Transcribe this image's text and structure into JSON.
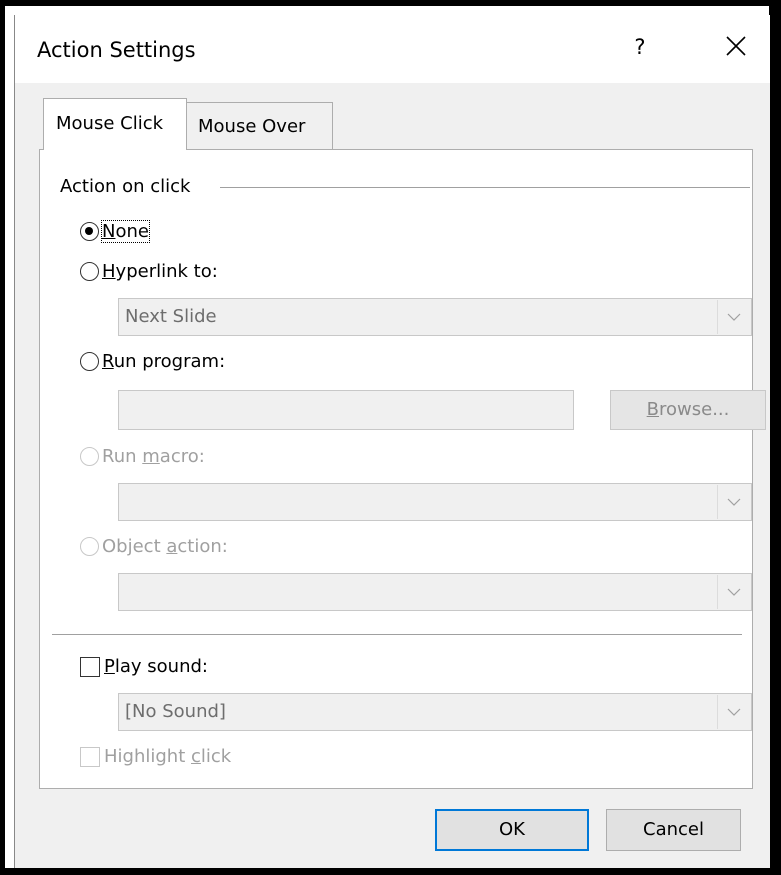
{
  "window": {
    "title": "Action Settings",
    "help_label": "?",
    "close_icon": "close-icon"
  },
  "tabs": [
    {
      "label": "Mouse Click",
      "active": true
    },
    {
      "label": "Mouse Over",
      "active": false
    }
  ],
  "action_group": {
    "label": "Action on click",
    "options": {
      "none": {
        "pre": "",
        "accel": "N",
        "post": "one",
        "checked": true,
        "enabled": true
      },
      "hyperlink": {
        "pre": "",
        "accel": "H",
        "post": "yperlink to:",
        "checked": false,
        "enabled": true
      },
      "run_program": {
        "pre": "",
        "accel": "R",
        "post": "un program:",
        "checked": false,
        "enabled": true
      },
      "run_macro": {
        "pre": "Run ",
        "accel": "m",
        "post": "acro:",
        "checked": false,
        "enabled": false
      },
      "object_action": {
        "pre": "Object ",
        "accel": "a",
        "post": "ction:",
        "checked": false,
        "enabled": false
      }
    },
    "hyperlink_value": "Next Slide",
    "program_value": "",
    "browse_button": {
      "pre": "",
      "accel": "B",
      "post": "rowse..."
    },
    "macro_value": "",
    "object_action_value": ""
  },
  "sound": {
    "play_sound": {
      "pre": "",
      "accel": "P",
      "post": "lay sound:",
      "checked": false
    },
    "sound_value": "[No Sound]",
    "highlight_click": {
      "pre": "Highlight ",
      "accel": "c",
      "post": "lick",
      "checked": false,
      "enabled": false
    }
  },
  "buttons": {
    "ok": "OK",
    "cancel": "Cancel"
  },
  "colors": {
    "accent": "#0078d7",
    "disabled_text": "#a0a0a0",
    "dialog_bg": "#f0f0f0"
  }
}
